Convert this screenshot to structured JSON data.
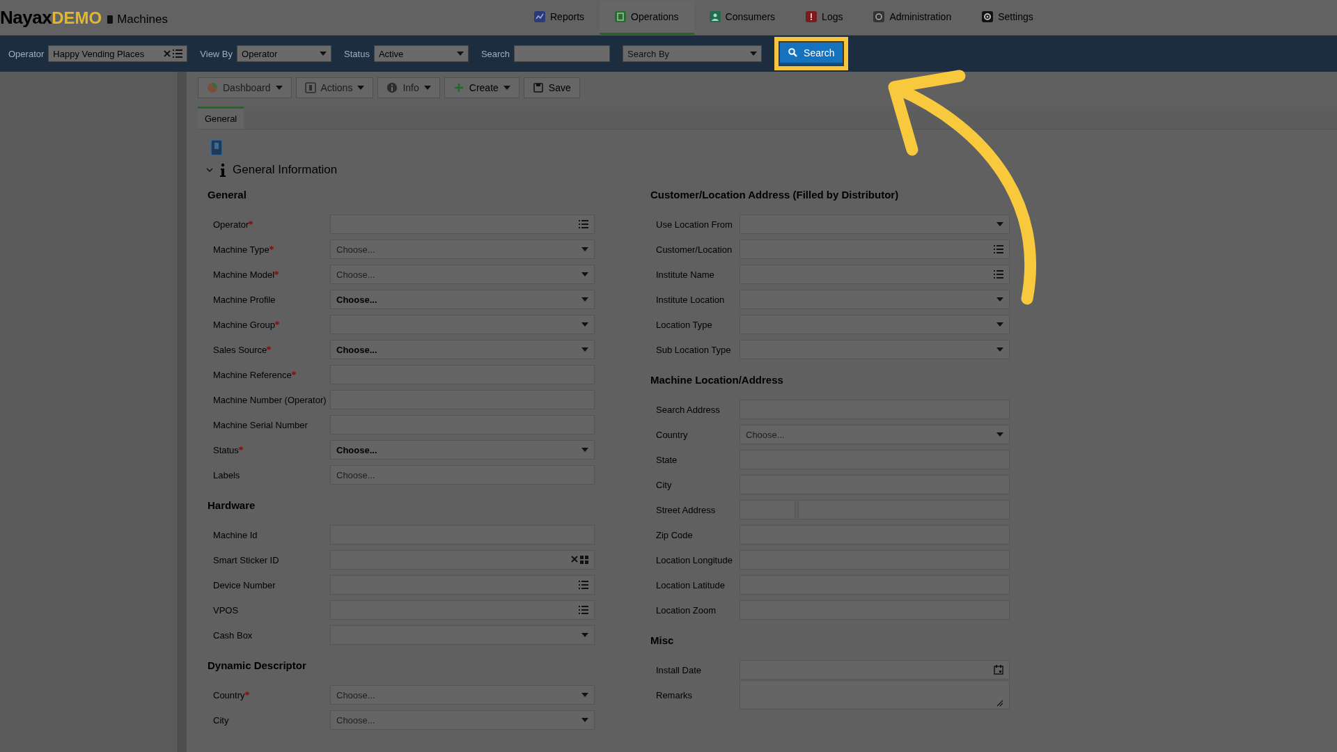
{
  "header": {
    "brand": "Nayax",
    "badge": "DEMO",
    "page_title": "Machines",
    "nav": [
      {
        "label": "Reports",
        "selected": false
      },
      {
        "label": "Operations",
        "selected": true
      },
      {
        "label": "Consumers",
        "selected": false
      },
      {
        "label": "Logs",
        "selected": false
      },
      {
        "label": "Administration",
        "selected": false
      },
      {
        "label": "Settings",
        "selected": false
      }
    ]
  },
  "filter_bar": {
    "fields": [
      {
        "label": "Operator",
        "kind": "lookup",
        "value": "Happy Vending Places"
      },
      {
        "label": "View By",
        "kind": "select",
        "value": "Operator"
      },
      {
        "label": "Status",
        "kind": "select",
        "value": "Active"
      },
      {
        "label": "Search",
        "kind": "text"
      },
      {
        "kind": "select",
        "placeholder": "Search By"
      }
    ],
    "search_button": {
      "label": "Search",
      "highlighted": true
    }
  },
  "toolbar": [
    {
      "label": "Dashboard",
      "dropdown": true,
      "disabled": true
    },
    {
      "label": "Actions",
      "dropdown": true,
      "disabled": true
    },
    {
      "label": "Info",
      "dropdown": true,
      "disabled": true
    },
    {
      "label": "Create",
      "dropdown": true,
      "disabled": false
    },
    {
      "label": "Save",
      "dropdown": false,
      "disabled": false
    }
  ],
  "tabs": [
    {
      "label": "General",
      "selected": true
    }
  ],
  "section": {
    "title": "General Information",
    "expanded": true
  },
  "left_groups": [
    {
      "title": "General",
      "fields": [
        {
          "label": "Operator",
          "required": true,
          "kind": "list"
        },
        {
          "label": "Machine Type",
          "required": true,
          "kind": "select",
          "placeholder": "Choose..."
        },
        {
          "label": "Machine Model",
          "required": true,
          "kind": "select",
          "placeholder": "Choose..."
        },
        {
          "label": "Machine Profile",
          "required": false,
          "kind": "select",
          "value": "Choose..."
        },
        {
          "label": "Machine Group",
          "required": true,
          "kind": "select"
        },
        {
          "label": "Sales Source",
          "required": true,
          "kind": "select",
          "value": "Choose..."
        },
        {
          "label": "Machine Reference",
          "required": true,
          "kind": "text"
        },
        {
          "label": "Machine Number (Operator)",
          "required": false,
          "kind": "text"
        },
        {
          "label": "Machine Serial Number",
          "required": false,
          "kind": "text"
        },
        {
          "label": "Status",
          "required": true,
          "kind": "select",
          "value": "Choose..."
        },
        {
          "label": "Labels",
          "required": false,
          "kind": "text",
          "placeholder": "Choose..."
        }
      ]
    },
    {
      "title": "Hardware",
      "fields": [
        {
          "label": "Machine Id",
          "required": false,
          "kind": "text"
        },
        {
          "label": "Smart Sticker ID",
          "required": false,
          "kind": "sticker"
        },
        {
          "label": "Device Number",
          "required": false,
          "kind": "list"
        },
        {
          "label": "VPOS",
          "required": false,
          "kind": "list"
        },
        {
          "label": "Cash Box",
          "required": false,
          "kind": "select"
        }
      ]
    },
    {
      "title": "Dynamic Descriptor",
      "fields": [
        {
          "label": "Country",
          "required": true,
          "kind": "select",
          "placeholder": "Choose..."
        },
        {
          "label": "City",
          "required": false,
          "kind": "select",
          "placeholder": "Choose..."
        }
      ]
    }
  ],
  "right_groups": [
    {
      "title": "Customer/Location Address (Filled by Distributor)",
      "fields": [
        {
          "label": "Use Location From",
          "required": false,
          "kind": "select"
        },
        {
          "label": "Customer/Location",
          "required": false,
          "kind": "list"
        },
        {
          "label": "Institute Name",
          "required": false,
          "kind": "list"
        },
        {
          "label": "Institute Location",
          "required": false,
          "kind": "select"
        },
        {
          "label": "Location Type",
          "required": false,
          "kind": "select"
        },
        {
          "label": "Sub Location Type",
          "required": false,
          "kind": "select"
        }
      ]
    },
    {
      "title": "Machine Location/Address",
      "fields": [
        {
          "label": "Search Address",
          "required": false,
          "kind": "text"
        },
        {
          "label": "Country",
          "required": false,
          "kind": "select",
          "placeholder": "Choose..."
        },
        {
          "label": "State",
          "required": false,
          "kind": "text"
        },
        {
          "label": "City",
          "required": false,
          "kind": "text"
        },
        {
          "label": "Street Address",
          "required": false,
          "kind": "split"
        },
        {
          "label": "Zip Code",
          "required": false,
          "kind": "text"
        },
        {
          "label": "Location Longitude",
          "required": false,
          "kind": "text"
        },
        {
          "label": "Location Latitude",
          "required": false,
          "kind": "text"
        },
        {
          "label": "Location Zoom",
          "required": false,
          "kind": "text"
        }
      ]
    },
    {
      "title": "Misc",
      "fields": [
        {
          "label": "Install Date",
          "required": false,
          "kind": "date"
        },
        {
          "label": "Remarks",
          "required": false,
          "kind": "textarea"
        }
      ]
    }
  ]
}
